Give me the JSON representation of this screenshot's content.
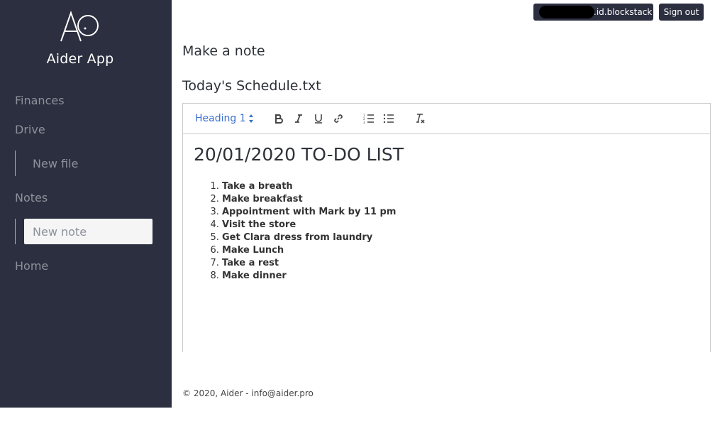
{
  "sidebar": {
    "app_name": "Aider App",
    "items": [
      {
        "label": "Finances"
      },
      {
        "label": "Drive"
      },
      {
        "label": "New file"
      },
      {
        "label": "Notes"
      },
      {
        "label": "New note"
      },
      {
        "label": "Home"
      }
    ]
  },
  "header": {
    "user_id_suffix": ".id.blockstack",
    "signout_label": "Sign out"
  },
  "main": {
    "page_title": "Make a note",
    "file_name": "Today's Schedule.txt",
    "toolbar": {
      "heading_select": "Heading 1",
      "icons": [
        "bold-icon",
        "italic-icon",
        "underline-icon",
        "link-icon",
        "ordered-list-icon",
        "bullet-list-icon",
        "clear-format-icon"
      ]
    },
    "document": {
      "heading": "20/01/2020 TO-DO LIST",
      "items": [
        "Take a breath",
        "Make breakfast",
        "Appointment with Mark by 11 pm",
        "Visit the store",
        "Get Clara dress from laundry",
        "Make Lunch",
        "Take a rest",
        "Make dinner"
      ]
    }
  },
  "footer": {
    "text": "© 2020, Aider - info@aider.pro"
  },
  "colors": {
    "sidebar_bg": "#2b2f3f",
    "accent": "#3a6fcf"
  }
}
